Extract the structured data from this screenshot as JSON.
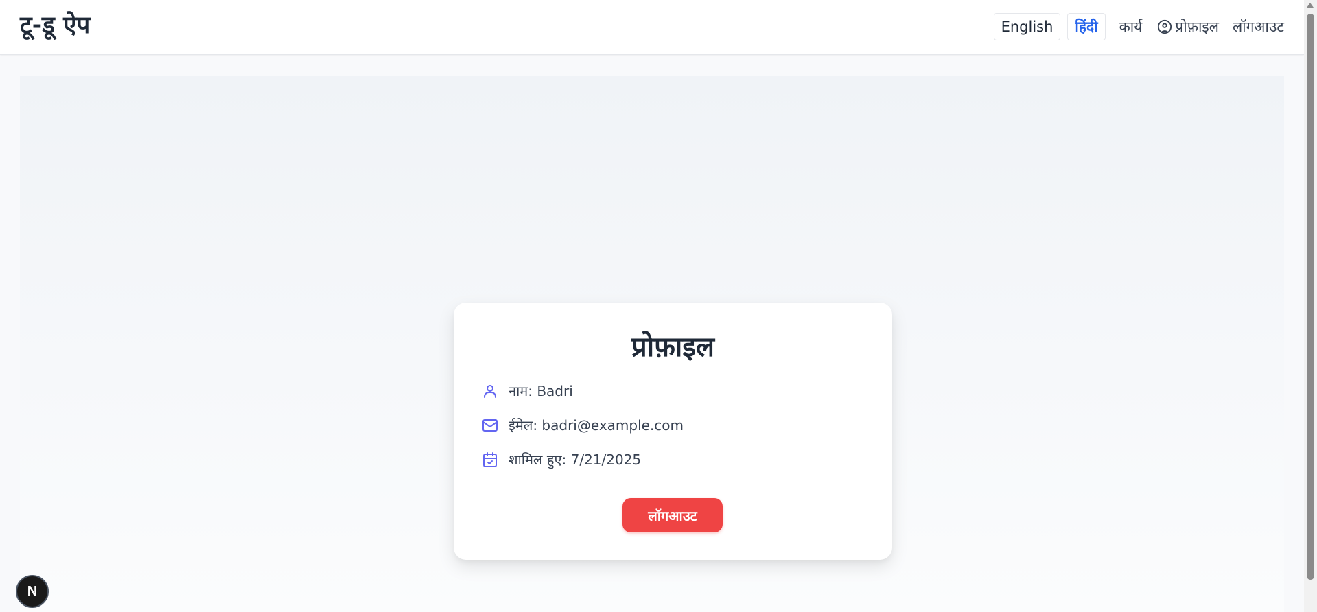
{
  "header": {
    "app_title": "टू-डू ऐप",
    "lang_english": "English",
    "lang_hindi": "हिंदी",
    "nav_tasks": "कार्य",
    "nav_profile": "प्रोफ़ाइल",
    "nav_logout": "लॉगआउट"
  },
  "profile": {
    "title": "प्रोफ़ाइल",
    "name_line": "नाम: Badri",
    "email_line": "ईमेल: badri@example.com",
    "joined_line": "शामिल हुए: 7/21/2025",
    "logout_button": "लॉगआउट"
  },
  "badge": {
    "letter": "N"
  },
  "icons": {
    "profile_nav": "user-circle-icon",
    "name": "user-icon",
    "email": "mail-icon",
    "joined": "calendar-check-icon"
  },
  "colors": {
    "accent_icon": "#6366f1",
    "active_language": "#2563eb",
    "logout_button": "#ef4444"
  }
}
